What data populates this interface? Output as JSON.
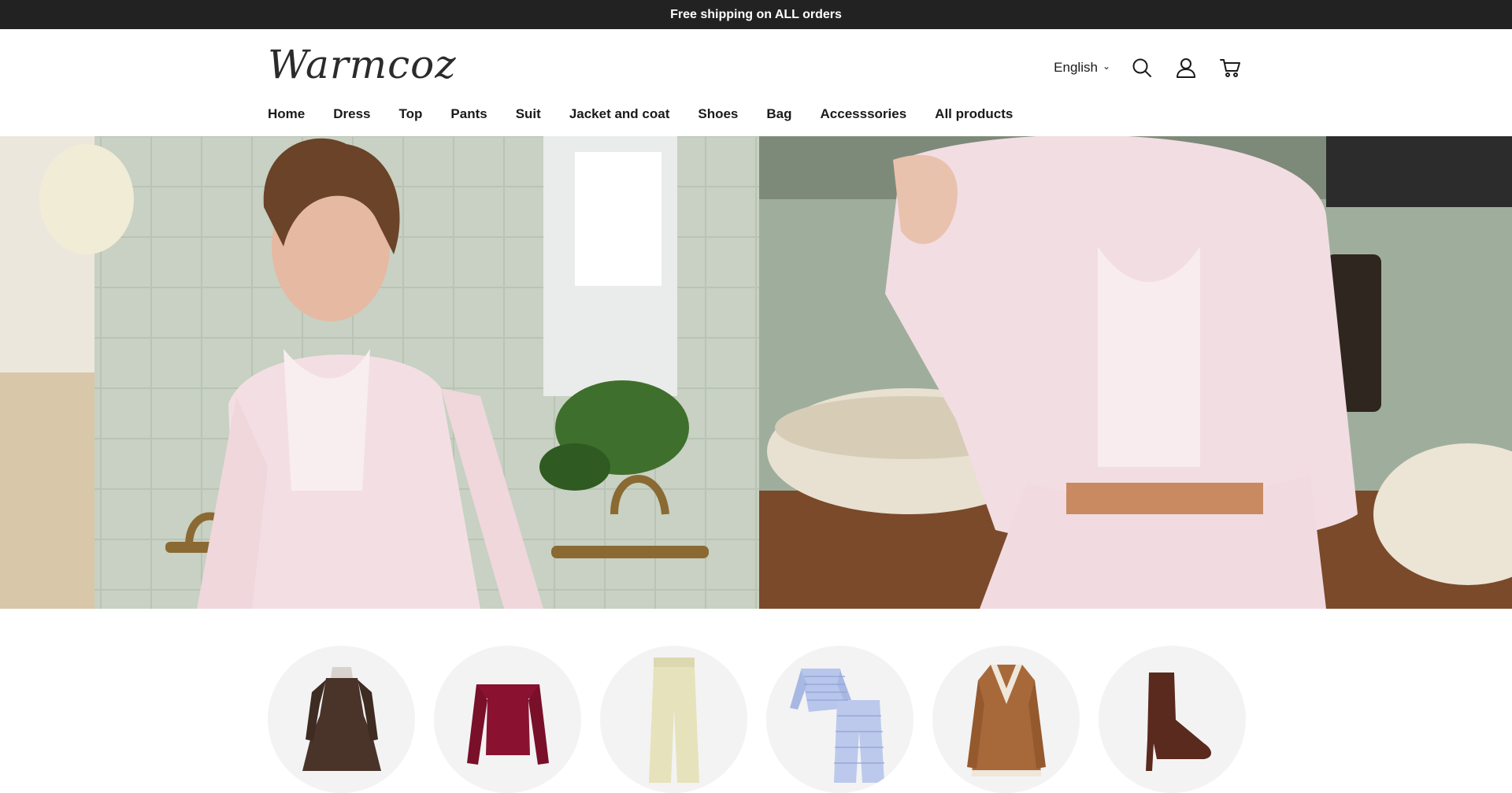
{
  "announcement": {
    "text": "Free shipping on ALL orders"
  },
  "header": {
    "logo_text": "Warmcoz",
    "language": "English",
    "icons": [
      "search-icon",
      "account-icon",
      "cart-icon"
    ]
  },
  "nav": {
    "items": [
      {
        "label": "Home"
      },
      {
        "label": "Dress"
      },
      {
        "label": "Top"
      },
      {
        "label": "Pants"
      },
      {
        "label": "Suit"
      },
      {
        "label": "Jacket and coat"
      },
      {
        "label": "Shoes"
      },
      {
        "label": "Bag"
      },
      {
        "label": "Accesssories"
      },
      {
        "label": "All products"
      }
    ]
  },
  "hero": {
    "images": [
      "hero-image-woman-pink-cardigan",
      "hero-image-cardigan-detail"
    ]
  },
  "categories": {
    "items": [
      {
        "image": "brown-dress"
      },
      {
        "image": "burgundy-top"
      },
      {
        "image": "cream-pants"
      },
      {
        "image": "striped-pajama-set"
      },
      {
        "image": "shearling-coat"
      },
      {
        "image": "brown-ankle-boot"
      }
    ]
  },
  "colors": {
    "announcement_bg": "#222222",
    "text": "#1a1a1a",
    "category_bg": "#f3f3f3"
  }
}
